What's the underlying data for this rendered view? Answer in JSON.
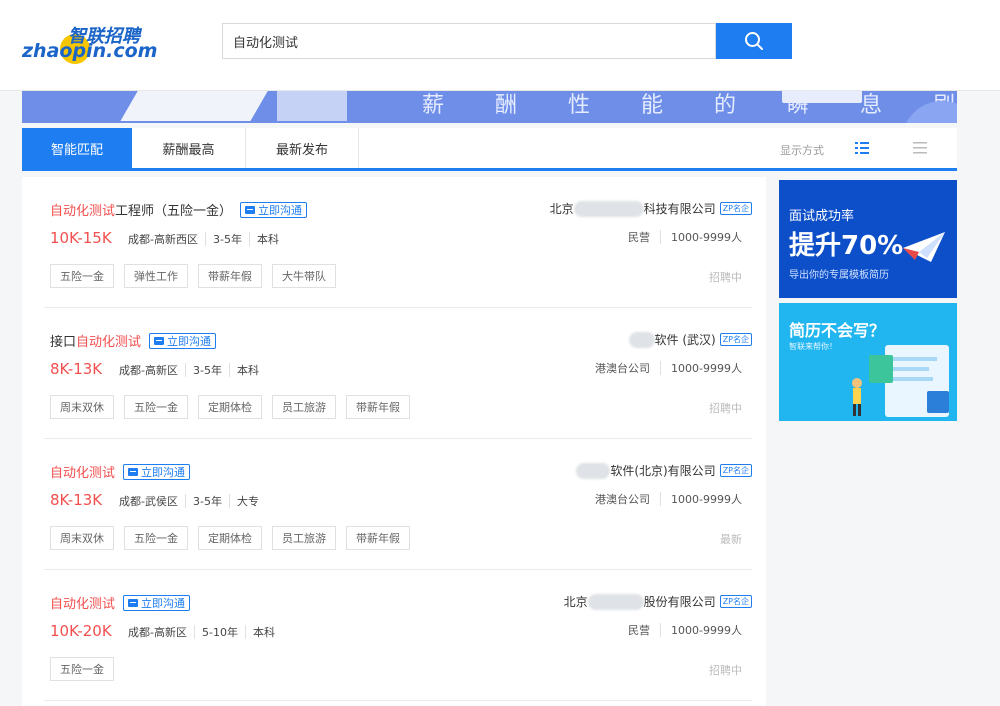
{
  "header": {
    "logo_en": "zhaopin.com",
    "logo_cn": "智联招聘",
    "search_value": "自动化测试",
    "search_icon": "search-icon"
  },
  "banner": {
    "text": "薪 酬 性 能 的 瞬 息 刷 新"
  },
  "tabs": {
    "items": [
      {
        "label": "智能匹配",
        "active": true
      },
      {
        "label": "薪酬最高",
        "active": false
      },
      {
        "label": "最新发布",
        "active": false
      }
    ],
    "display_label": "显示方式"
  },
  "jobs": [
    {
      "title_highlight": "自动化测试",
      "title_rest": "工程师（五险一金）",
      "chat_label": "立即沟通",
      "salary": "10K-15K",
      "location": "成都-高新西区",
      "experience": "3-5年",
      "education": "本科",
      "tags": [
        "五险一金",
        "弹性工作",
        "带薪年假",
        "大牛带队"
      ],
      "company_prefix": "北京",
      "company_suffix": "科技有限公司",
      "company_badge": "ZP名企",
      "company_type": "民营",
      "company_size": "1000-9999人",
      "status": "招聘中"
    },
    {
      "title_highlight": "自动化测试",
      "title_prefix": "接口",
      "chat_label": "立即沟通",
      "salary": "8K-13K",
      "location": "成都-高新区",
      "experience": "3-5年",
      "education": "本科",
      "tags": [
        "周末双休",
        "五险一金",
        "定期体检",
        "员工旅游",
        "带薪年假"
      ],
      "company_prefix": "",
      "company_suffix": "软件 (武汉)",
      "company_badge": "ZP名企",
      "company_type": "港澳台公司",
      "company_size": "1000-9999人",
      "status": "招聘中"
    },
    {
      "title_highlight": "自动化测试",
      "chat_label": "立即沟通",
      "salary": "8K-13K",
      "location": "成都-武侯区",
      "experience": "3-5年",
      "education": "大专",
      "tags": [
        "周末双休",
        "五险一金",
        "定期体检",
        "员工旅游",
        "带薪年假"
      ],
      "company_prefix": "",
      "company_suffix": "软件(北京)有限公司",
      "company_badge": "ZP名企",
      "company_type": "港澳台公司",
      "company_size": "1000-9999人",
      "status": "最新"
    },
    {
      "title_highlight": "自动化测试",
      "chat_label": "立即沟通",
      "salary": "10K-20K",
      "location": "成都-高新区",
      "experience": "5-10年",
      "education": "本科",
      "tags": [
        "五险一金"
      ],
      "company_prefix": "北京",
      "company_suffix": "股份有限公司",
      "company_badge": "ZP名企",
      "company_type": "民营",
      "company_size": "1000-9999人",
      "status": "招聘中"
    }
  ],
  "ads": {
    "ad1": {
      "line1": "面试成功率",
      "line2": "提升70%",
      "line3": "导出你的专属模板简历"
    },
    "ad2": {
      "line1": "简历不会写？",
      "line2": "智联来帮你！"
    }
  }
}
